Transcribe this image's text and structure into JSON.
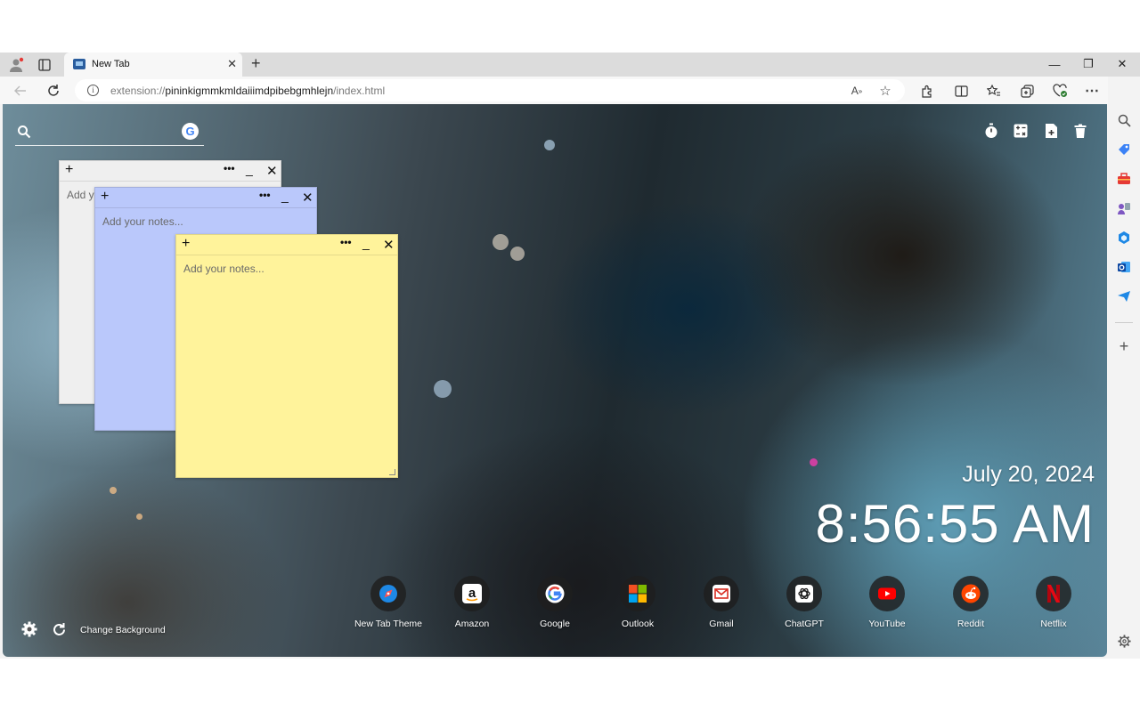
{
  "tab": {
    "title": "New Tab",
    "close": "✕",
    "new": "+"
  },
  "window": {
    "minimize": "—",
    "maximize": "❐",
    "close": "✕"
  },
  "address": {
    "scheme": "extension://",
    "host": "pininkigmmkmldaiiimdpibebgmhlejn",
    "path": "/index.html"
  },
  "notes": {
    "placeholder_1": "Add your notes...",
    "placeholder_2": "Add your notes...",
    "placeholder_3": "Add your notes...",
    "add": "+",
    "more": "•••",
    "minimize": "_",
    "close": "✕"
  },
  "clock": {
    "date": "July 20, 2024",
    "time": "8:56:55 AM"
  },
  "shortcuts": [
    {
      "label": "New Tab Theme",
      "icon": "compass-icon"
    },
    {
      "label": "Amazon",
      "icon": "amazon-icon"
    },
    {
      "label": "Google",
      "icon": "google-icon"
    },
    {
      "label": "Outlook",
      "icon": "microsoft-icon"
    },
    {
      "label": "Gmail",
      "icon": "gmail-icon"
    },
    {
      "label": "ChatGPT",
      "icon": "chatgpt-icon"
    },
    {
      "label": "YouTube",
      "icon": "youtube-icon"
    },
    {
      "label": "Reddit",
      "icon": "reddit-icon"
    },
    {
      "label": "Netflix",
      "icon": "netflix-icon"
    }
  ],
  "bottom": {
    "change_background": "Change Background"
  },
  "colors": {
    "note_gray": "#efefef",
    "note_blue": "#bac8fb",
    "note_yellow": "#fff39b",
    "edge_accent": "#1a73e8"
  }
}
